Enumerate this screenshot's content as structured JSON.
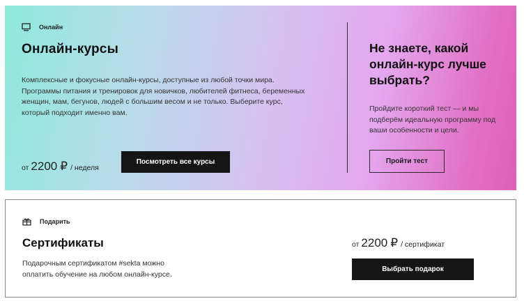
{
  "online": {
    "tag_icon": "monitor-icon",
    "tag_label": "Онлайн",
    "title": "Онлайн-курсы",
    "description": "Комплексные и фокусные онлайн-курсы, доступные из любой точки мира. Программы питания и тренировок для новичков, любителей фитнеса, беременных женщин, мам, бегунов, людей с большим весом и не только. Выберите курс, который подходит именно вам.",
    "price_prefix": "от",
    "price_amount": "2200",
    "price_currency": "₽",
    "price_unit": "/ неделя",
    "button_label": "Посмотреть все курсы",
    "gradient_colors": [
      "#8ee9de",
      "#d4c3f1",
      "#e4a6ee",
      "#de5fb7"
    ]
  },
  "quiz": {
    "title": "Не знаете, какой онлайн-курс лучше выбрать?",
    "description": "Пройдите короткий тест — и мы подберём идеальную программу под ваши особенности и цели.",
    "button_label": "Пройти тест"
  },
  "gift": {
    "tag_icon": "gift-icon",
    "tag_label": "Подарить",
    "title": "Сертификаты",
    "description": "Подарочным сертификатом #sekta можно оплатить обучение на любом онлайн-курсе.",
    "price_prefix": "от",
    "price_amount": "2200",
    "price_currency": "₽",
    "price_unit": "/ сертификат",
    "button_label": "Выбрать подарок"
  },
  "colors": {
    "button_dark": "#151515",
    "text_dark": "#111111",
    "border": "#8a8a8a"
  }
}
